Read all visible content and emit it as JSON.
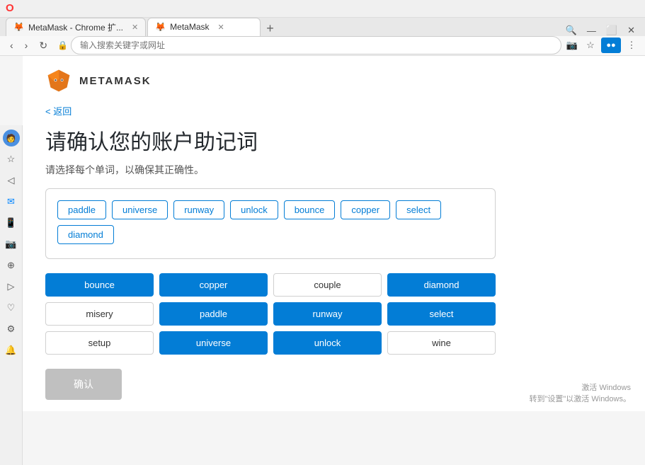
{
  "browser": {
    "titlebar": {
      "opera_icon": "O"
    },
    "tabs": [
      {
        "id": "tab1",
        "label": "MetaMask - Chrome 扩...",
        "active": false,
        "icon": "🦊"
      },
      {
        "id": "tab2",
        "label": "MetaMask",
        "active": true,
        "icon": "🦊"
      }
    ],
    "new_tab_label": "+",
    "toolbar": {
      "back_label": "‹",
      "forward_label": "›",
      "refresh_label": "↻",
      "home_label": "⌂",
      "lock_label": "🔒",
      "address_placeholder": "输入搜索关键字或网址",
      "extensions_label": "⊞",
      "bookmark_label": "☆",
      "settings_label": "⋮"
    },
    "sidebar_icons": [
      "☆",
      "◁",
      "♡",
      "✉",
      "📷",
      "⊕",
      "▷",
      "♡",
      "⚙",
      "🔔"
    ]
  },
  "page": {
    "back_label": "< 返回",
    "title": "请确认您的账户助记词",
    "subtitle": "请选择每个单词，以确保其正确性。",
    "confirm_label": "确认",
    "brand": "METAMASK"
  },
  "selected_box": {
    "words": [
      "paddle",
      "universe",
      "runway",
      "unlock",
      "bounce",
      "copper",
      "select",
      "diamond"
    ]
  },
  "word_grid": {
    "words": [
      {
        "label": "bounce",
        "style": "blue"
      },
      {
        "label": "copper",
        "style": "blue"
      },
      {
        "label": "couple",
        "style": "white"
      },
      {
        "label": "diamond",
        "style": "blue"
      },
      {
        "label": "misery",
        "style": "white"
      },
      {
        "label": "paddle",
        "style": "blue"
      },
      {
        "label": "runway",
        "style": "blue"
      },
      {
        "label": "select",
        "style": "blue"
      },
      {
        "label": "setup",
        "style": "white"
      },
      {
        "label": "universe",
        "style": "blue"
      },
      {
        "label": "unlock",
        "style": "blue"
      },
      {
        "label": "wine",
        "style": "white"
      }
    ]
  },
  "windows_activate": {
    "line1": "激活 Windows",
    "line2": "转到\"设置\"以激活 Windows。"
  }
}
